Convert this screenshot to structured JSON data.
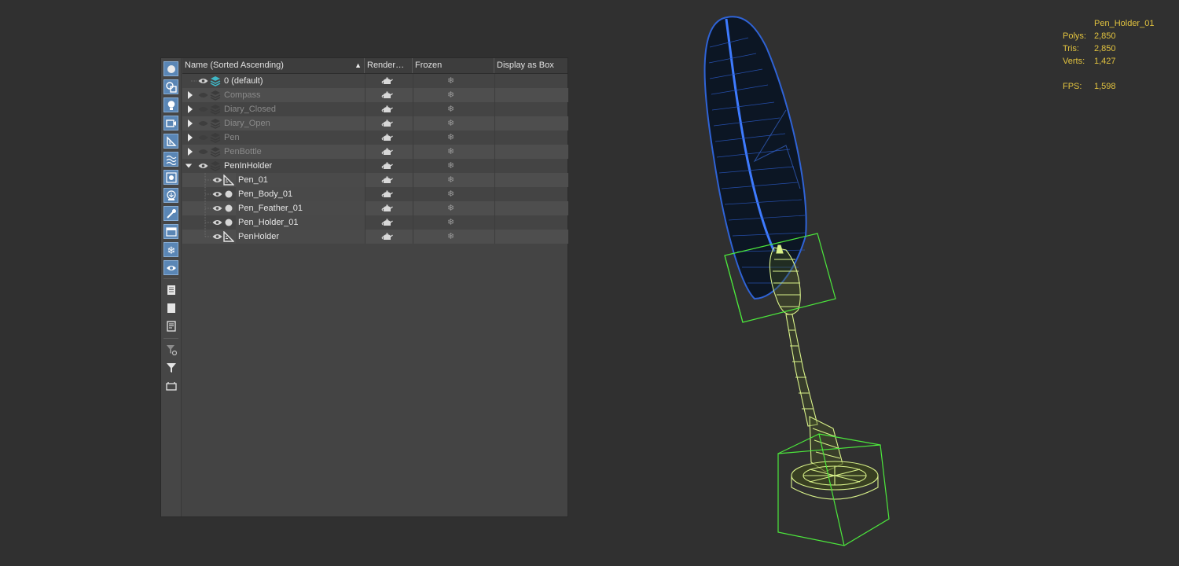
{
  "explorer": {
    "columns": {
      "name": "Name (Sorted Ascending)",
      "renderable": "Render…",
      "frozen": "Frozen",
      "display_as_box": "Display as Box"
    },
    "rows": [
      {
        "label": "0 (default)"
      },
      {
        "label": "Compass"
      },
      {
        "label": "Diary_Closed"
      },
      {
        "label": "Diary_Open"
      },
      {
        "label": "Pen"
      },
      {
        "label": "PenBottle"
      },
      {
        "label": "PenInHolder"
      },
      {
        "label": "Pen_01"
      },
      {
        "label": "Pen_Body_01"
      },
      {
        "label": "Pen_Feather_01"
      },
      {
        "label": "Pen_Holder_01"
      },
      {
        "label": "PenHolder"
      }
    ],
    "frozen_glyph": "❄",
    "sort_glyph": "▲"
  },
  "viewport": {
    "selected_object": "Pen_Holder_01",
    "stats": {
      "polys_label": "Polys:",
      "polys": "2,850",
      "tris_label": "Tris:",
      "tris": "2,850",
      "verts_label": "Verts:",
      "verts": "1,427",
      "fps_label": "FPS:",
      "fps": "1,598"
    }
  },
  "colors": {
    "accent_blue": "#5a86b5",
    "stats_text": "#e2c33f",
    "layer_active": "#3fb7c6",
    "feather_wire": "#2f63d6",
    "holder_wire": "#d9f28a",
    "bbox": "#4ce83c"
  }
}
